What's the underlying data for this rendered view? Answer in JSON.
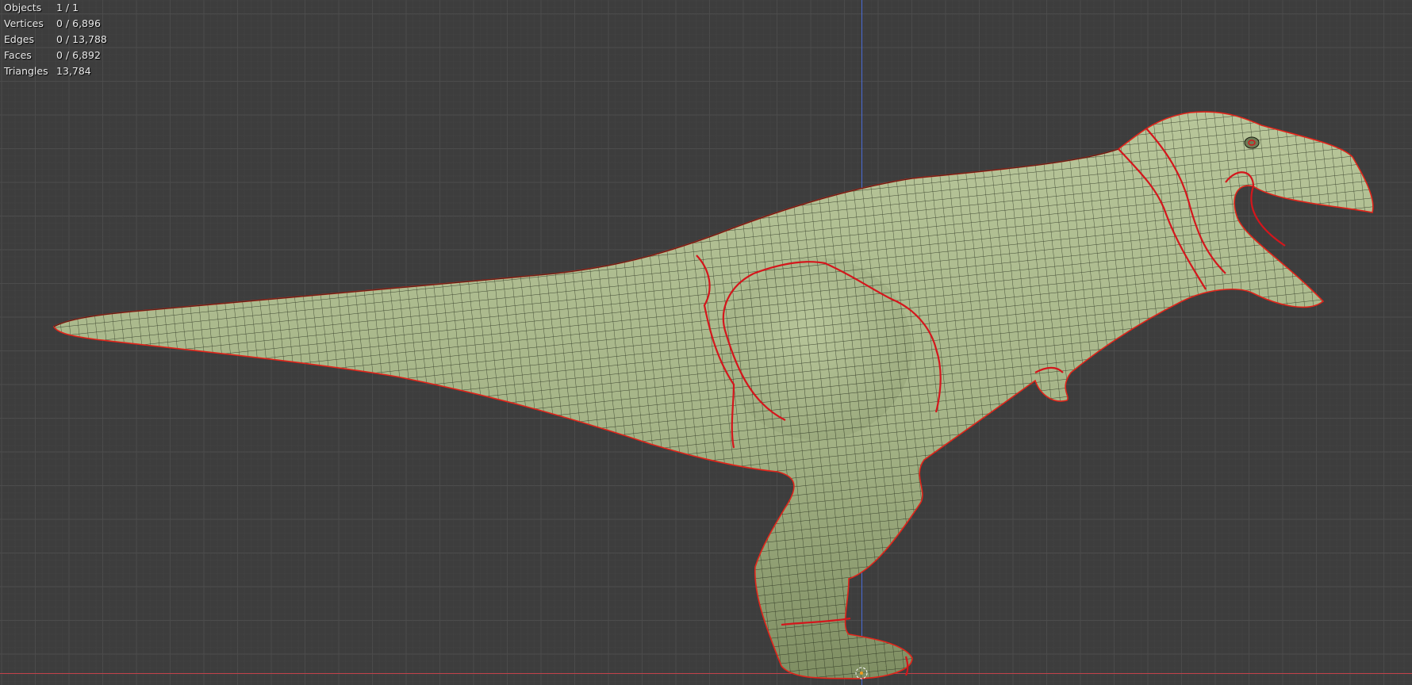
{
  "viewport": {
    "background_color": "#3d3d3d",
    "axis_x_color": "#c2424a",
    "axis_z_color": "#4a6bd6"
  },
  "stats": {
    "objects_label": "Objects",
    "objects_value": "1 / 1",
    "vertices_label": "Vertices",
    "vertices_value": "0 / 6,896",
    "edges_label": "Edges",
    "edges_value": "0 / 13,788",
    "faces_label": "Faces",
    "faces_value": "0 / 6,892",
    "triangles_label": "Triangles",
    "triangles_value": "13,784"
  },
  "model": {
    "shading_color": "#a9b88c",
    "wire_color": "#1c2314",
    "outline_color": "#e0251b",
    "seam_color": "#d4161c"
  }
}
